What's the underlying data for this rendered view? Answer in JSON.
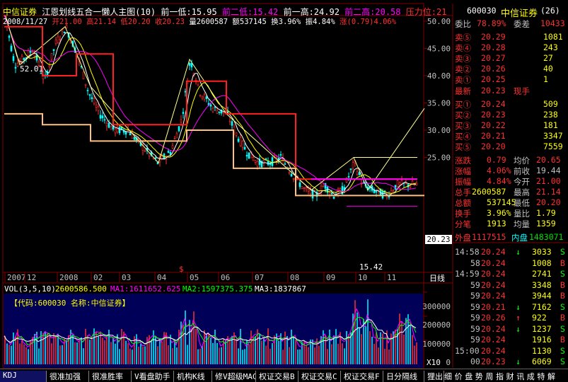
{
  "header": {
    "stock_name": "中信证券",
    "indicator": "江恩划线五合一懒人主图(10)",
    "prev_low_label": "前一低:15.95",
    "prev2_low_label": "前二低:15.42",
    "prev_high_label": "前一高:24.92",
    "prev2_high_label": "前二高:20.58",
    "pressure_label": "压力位:21"
  },
  "subheader": {
    "date": "2008/11/27",
    "open": "开21.00",
    "high": "高21.14",
    "low": "低20.20",
    "close": "收20.23",
    "volume": "量2600587",
    "amount": "额537145",
    "turnover": "换3.96%",
    "amplitude": "振4.84%",
    "change": "涨(0.79)4.06%"
  },
  "price_axis": [
    "55.00",
    "50.00",
    "45.00",
    "40.00",
    "35.00",
    "30.00",
    "25.00",
    "20.23"
  ],
  "annotations": {
    "high_mark": "52.01",
    "low_mark": "15.42",
    "current_price": "20.23"
  },
  "time_axis": [
    "2007",
    "12",
    "2008",
    "02",
    "03",
    "04",
    "05",
    "06",
    "07",
    "08",
    "09",
    "10",
    "11"
  ],
  "period_label": "日线",
  "dollar_mark": "$",
  "volume_header": {
    "name": "VOL(3,5,10)",
    "value": "2600586.500",
    "ma1": "MA1:1611652.625",
    "ma2": "MA2:1597375.375",
    "ma3": "MA3:1837867"
  },
  "volume_axis": [
    "300000",
    "200000",
    "100000",
    "0"
  ],
  "volume_unit": "X10",
  "code_label": "【代码:600030  名称:中信证券】",
  "quote": {
    "code": "600030",
    "name": "中信证券",
    "count": "(26)",
    "weibi_label": "委比",
    "weibi": "78.89%",
    "weicha_label": "委差",
    "weicha": "10433",
    "sells": [
      {
        "label": "卖⑤",
        "price": "20.29",
        "vol": "1081"
      },
      {
        "label": "卖④",
        "price": "20.28",
        "vol": "243"
      },
      {
        "label": "卖③",
        "price": "20.27",
        "vol": "27"
      },
      {
        "label": "卖②",
        "price": "20.26",
        "vol": "40"
      },
      {
        "label": "卖①",
        "price": "20.25",
        "vol": "1"
      }
    ],
    "latest_label": "最新",
    "latest": "20.23",
    "xianshou_label": "现手",
    "buys": [
      {
        "label": "买①",
        "price": "20.24",
        "vol": "509"
      },
      {
        "label": "买②",
        "price": "20.23",
        "vol": "238"
      },
      {
        "label": "买③",
        "price": "20.22",
        "vol": "181"
      },
      {
        "label": "买④",
        "price": "20.21",
        "vol": "3347"
      },
      {
        "label": "买⑤",
        "price": "20.20",
        "vol": "7559"
      }
    ],
    "stats": [
      {
        "l1": "涨跌",
        "v1": "0.79",
        "l2": "均价",
        "v2": "20.65"
      },
      {
        "l1": "涨幅",
        "v1": "4.06%",
        "l2": "前收",
        "v2": "19.44"
      },
      {
        "l1": "振幅",
        "v1": "4.84%",
        "l2": "今开",
        "v2": "21.00"
      },
      {
        "l1": "总手",
        "v1": "2600587",
        "l2": "最高",
        "v2": "21.14"
      },
      {
        "l1": "总额",
        "v1": "537145",
        "l2": "最低",
        "v2": "20.20"
      },
      {
        "l1": "换手",
        "v1": "3.96%",
        "l2": "量比",
        "v2": "1.79"
      },
      {
        "l1": "分笔",
        "v1": "1913",
        "l2": "均量",
        "v2": "1359"
      }
    ],
    "waipan_label": "外盘",
    "waipan": "1117515",
    "neipan_label": "内盘",
    "neipan": "1483071",
    "ticks": [
      {
        "time": "14:58",
        "price": "20.24",
        "arrow": "↓",
        "vol": "3033",
        "bs": "S"
      },
      {
        "time": "58",
        "price": "20.24",
        "arrow": "",
        "vol": "1008",
        "bs": "B"
      },
      {
        "time": "14:59",
        "price": "20.24",
        "arrow": "",
        "vol": "2741",
        "bs": "S"
      },
      {
        "time": "59",
        "price": "20.24",
        "arrow": "",
        "vol": "3348",
        "bs": "B"
      },
      {
        "time": "59",
        "price": "20.24",
        "arrow": "",
        "vol": "3944",
        "bs": "B"
      },
      {
        "time": "59",
        "price": "20.21",
        "arrow": "↓",
        "vol": "7162",
        "bs": "S"
      },
      {
        "time": "59",
        "price": "20.26",
        "arrow": "↑",
        "vol": "922",
        "bs": "B"
      },
      {
        "time": "59",
        "price": "20.24",
        "arrow": "↓",
        "vol": "1237",
        "bs": "S"
      },
      {
        "time": "59",
        "price": "20.24",
        "arrow": "",
        "vol": "1916",
        "bs": "B"
      },
      {
        "time": "15:00",
        "price": "20.24",
        "arrow": "",
        "vol": "1130",
        "bs": "S"
      },
      {
        "time": "00",
        "price": "20.23",
        "arrow": "↓",
        "vol": "6069",
        "bs": "S"
      }
    ]
  },
  "bottom_tabs": [
    "KDJ",
    "很准加强",
    "很准胜率",
    "V看盘助手",
    "机构K线",
    "修V超级MACD",
    "权证交易B",
    "权证交易C",
    "权证交易F",
    "日分隔线",
    "狸出击"
  ],
  "right_tabs": [
    "细",
    "价",
    "盘",
    "势",
    "周",
    "指",
    "财",
    "讯",
    "成",
    "特",
    "解"
  ],
  "colors": {
    "up": "#ff3030",
    "down": "#00ffff",
    "grid": "#800000",
    "accent": "#ffff00",
    "magenta": "#ff00ff"
  }
}
